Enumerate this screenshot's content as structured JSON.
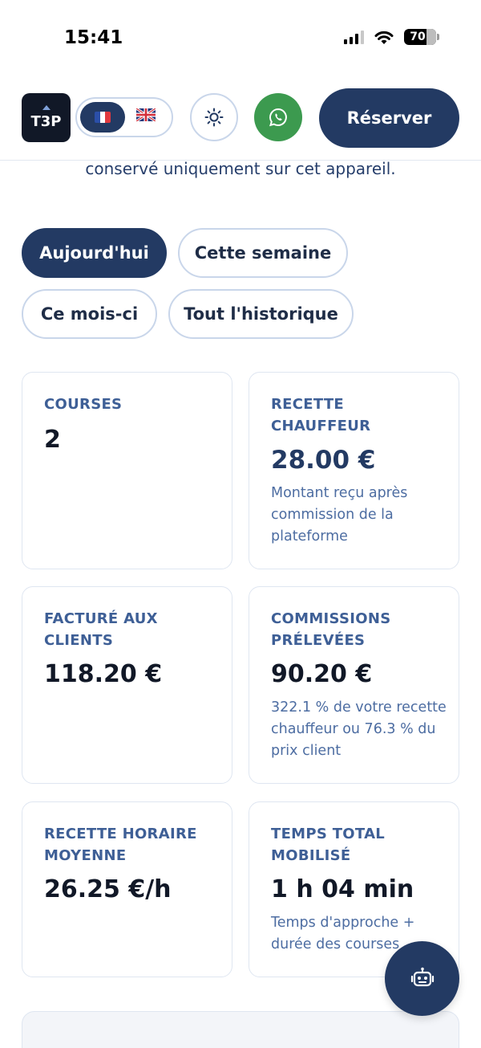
{
  "status_bar": {
    "time": "15:41",
    "battery": "70",
    "icons": [
      "signal-icon",
      "wifi-icon",
      "battery-icon"
    ]
  },
  "header": {
    "logo_text": "T3P",
    "languages": [
      {
        "code": "fr",
        "icon": "flag-fr-icon",
        "active": true
      },
      {
        "code": "en",
        "icon": "flag-uk-icon",
        "active": false
      }
    ],
    "theme_icon": "sun-icon",
    "whatsapp_icon": "whatsapp-icon",
    "reserve_label": "Réserver",
    "colors": {
      "primary": "#233a63",
      "whatsapp": "#3c9a4f"
    }
  },
  "note": "conservé uniquement sur cet appareil.",
  "filters": [
    {
      "label": "Aujourd'hui",
      "active": true
    },
    {
      "label": "Cette semaine",
      "active": false
    },
    {
      "label": "Ce mois-ci",
      "active": false
    },
    {
      "label": "Tout l'historique",
      "active": false
    }
  ],
  "stats": {
    "courses": {
      "label": "COURSES",
      "value": "2"
    },
    "recette_chauffeur": {
      "label": "RECETTE CHAUFFEUR",
      "value": "28.00 €",
      "note": "Montant reçu après commission de la plateforme"
    },
    "facture_clients": {
      "label": "FACTURÉ AUX CLIENTS",
      "value": "118.20 €"
    },
    "commissions": {
      "label": "COMMISSIONS PRÉLEVÉES",
      "value": "90.20 €",
      "note": "322.1 % de votre recette chauffeur ou 76.3 % du prix client"
    },
    "recette_horaire": {
      "label": "RECETTE HORAIRE MOYENNE",
      "value": "26.25 €/h"
    },
    "temps_total": {
      "label": "TEMPS TOTAL MOBILISÉ",
      "value": "1 h 04 min",
      "note": "Temps d'approche + durée des courses"
    }
  },
  "assistant_icon": "robot-icon"
}
